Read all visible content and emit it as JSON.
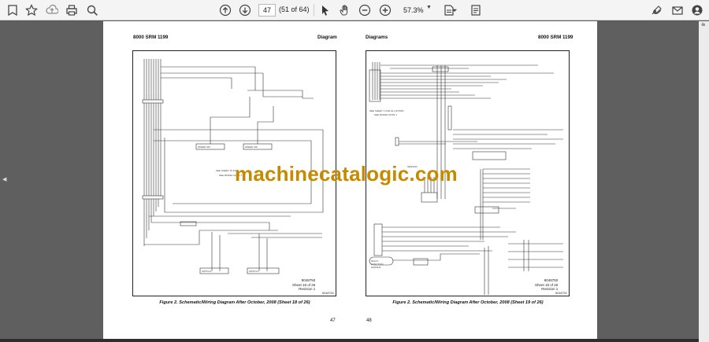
{
  "toolbar": {
    "page_current": "47",
    "page_count": "(51 of 64)",
    "zoom": "57.3%",
    "icons": [
      "bookmark-star-icon",
      "upload-icon",
      "print-icon",
      "zoom-search-icon",
      "page-up-icon",
      "page-down-icon",
      "select-cursor-icon",
      "hand-tool-icon",
      "zoom-out-icon",
      "zoom-in-icon",
      "fit-page-icon",
      "scroll-mode-icon",
      "sign-icon",
      "mail-icon",
      "account-icon"
    ]
  },
  "left_page": {
    "doc_id": "8000 SRM 1199",
    "section": "Diagrams",
    "caption": "Figure 2. Schematic/Wiring Diagram After October, 2008 (Sheet 18 of 26)",
    "sheet_note_1": "8048750",
    "sheet_note_2": "Sheet 18 of 26",
    "sheet_note_3": "Revision 1",
    "code": "8048750",
    "page_number": "47"
  },
  "right_page": {
    "doc_id": "8000 SRM 1199",
    "section": "Diagrams",
    "caption": "Figure 2. Schematic/Wiring Diagram After October, 2008 (Sheet 19 of 26)",
    "sheet_note_1": "8048750",
    "sheet_note_2": "Sheet 19 of 26",
    "sheet_note_3": "Revision 1",
    "code": "8048750",
    "page_number": "48"
  },
  "watermark": "machinecatalogic.com",
  "colors": {
    "watermark": "#c58a00",
    "background": "#5f5f5f",
    "toolbar": "#f4f4f4"
  }
}
